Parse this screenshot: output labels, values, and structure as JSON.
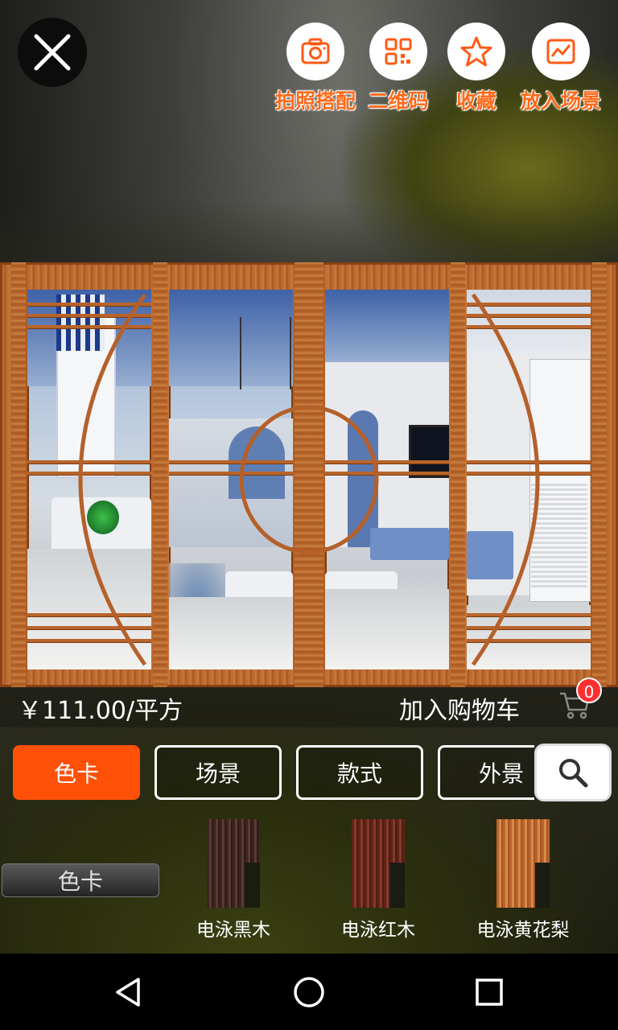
{
  "top_actions": [
    {
      "label": "拍照搭配",
      "icon": "camera-icon"
    },
    {
      "label": "二维码",
      "icon": "qr-code-icon"
    },
    {
      "label": "收藏",
      "icon": "star-icon"
    },
    {
      "label": "放入场景",
      "icon": "chart-icon"
    }
  ],
  "price": "￥111.00/平方",
  "add_to_cart_label": "加入购物车",
  "cart_count": "0",
  "tabs": [
    {
      "label": "色卡",
      "active": true
    },
    {
      "label": "场景",
      "active": false
    },
    {
      "label": "款式",
      "active": false
    },
    {
      "label": "外景",
      "active": false
    }
  ],
  "category_label": "色卡",
  "swatches": [
    {
      "name": "电泳黑木",
      "color": "#4a2d28"
    },
    {
      "name": "电泳红木",
      "color": "#6e2e22"
    },
    {
      "name": "电泳黄花梨",
      "color": "#c9783a"
    }
  ],
  "colors": {
    "accent": "#ff5008",
    "label_orange": "#ff6a1a",
    "badge_red": "#ff3030"
  }
}
